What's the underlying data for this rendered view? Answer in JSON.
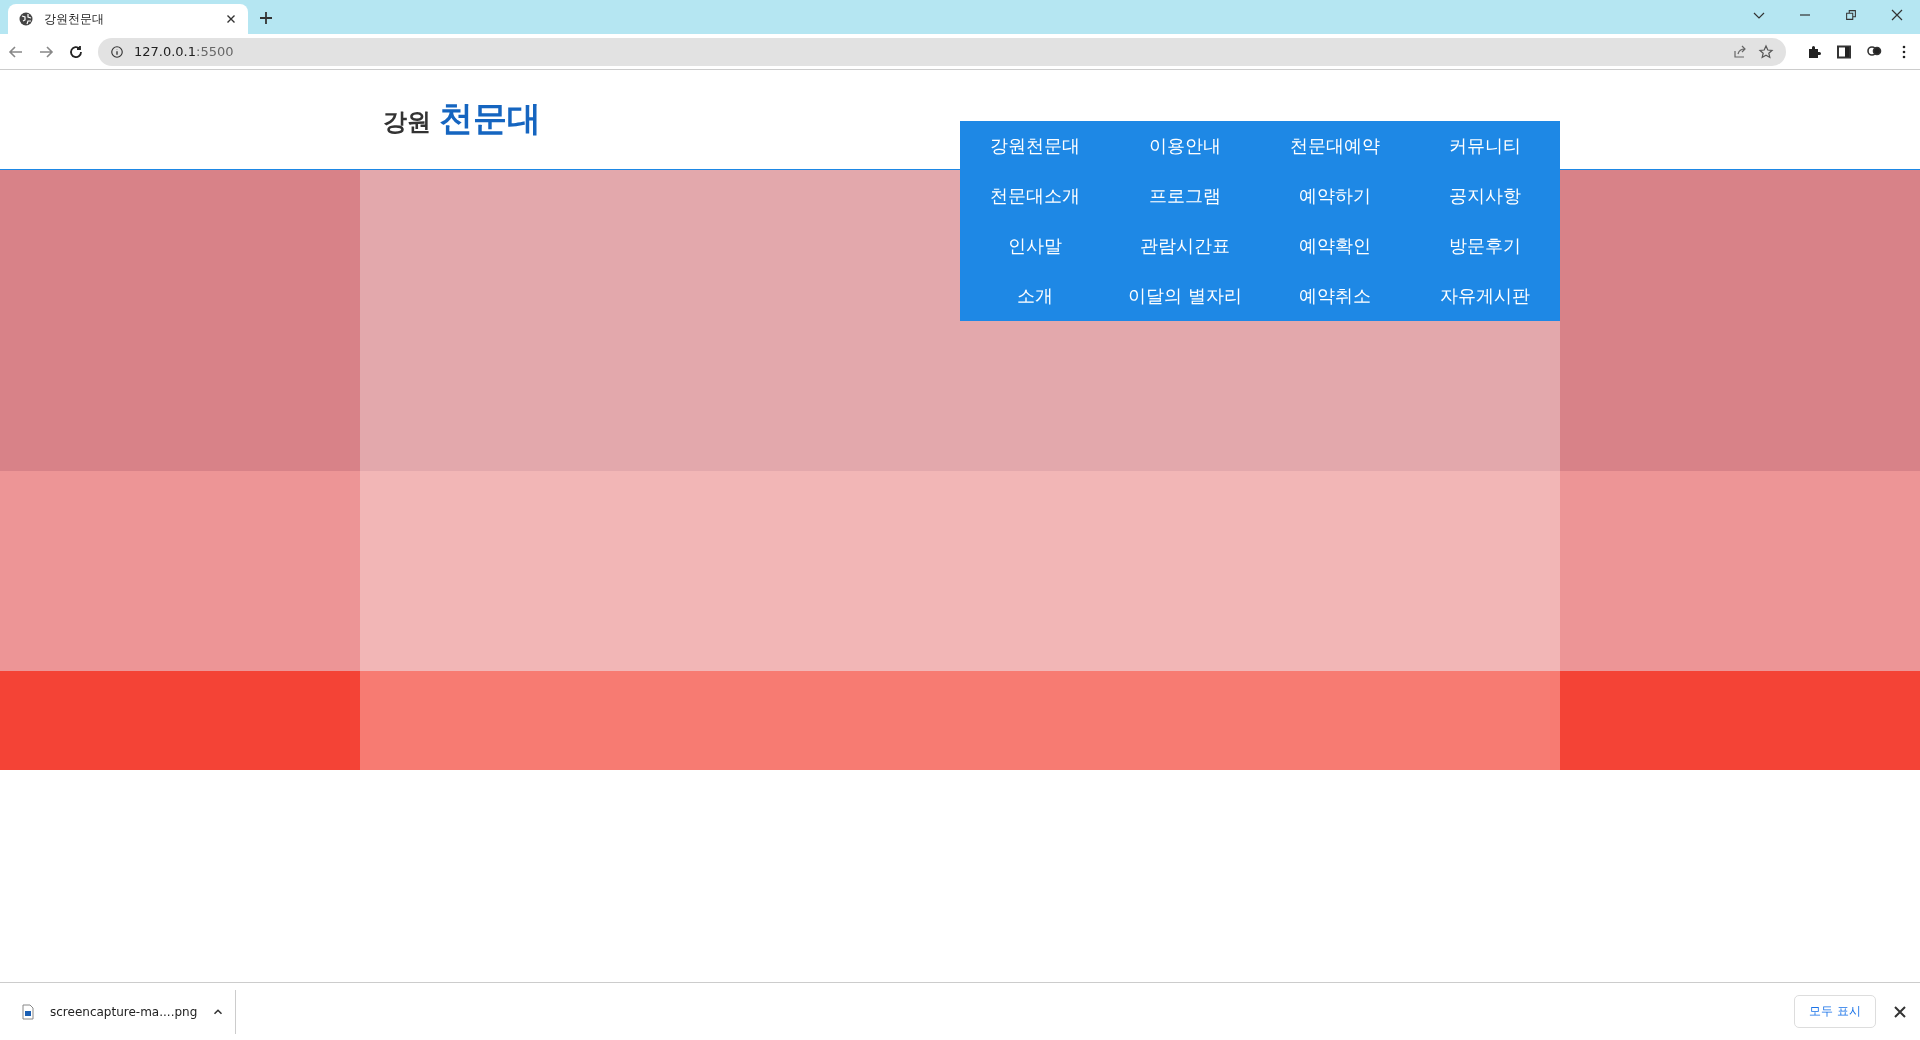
{
  "browser": {
    "tab": {
      "title": "강원천문대",
      "selected": true
    },
    "address": {
      "host": "127.0.0.1",
      "port": ":5500"
    }
  },
  "logo": {
    "region": "강원",
    "name": "천문대"
  },
  "menu": [
    {
      "label": "강원천문대",
      "children": [
        "천문대소개",
        "인사말",
        "소개"
      ]
    },
    {
      "label": "이용안내",
      "children": [
        "프로그램",
        "관람시간표",
        "이달의 별자리"
      ]
    },
    {
      "label": "천문대예약",
      "children": [
        "예약하기",
        "예약확인",
        "예약취소"
      ]
    },
    {
      "label": "커뮤니티",
      "children": [
        "공지사항",
        "방문후기",
        "자유게시판"
      ]
    }
  ],
  "download_bar": {
    "file": "screencapture-ma....png",
    "show_all": "모두 표시"
  }
}
